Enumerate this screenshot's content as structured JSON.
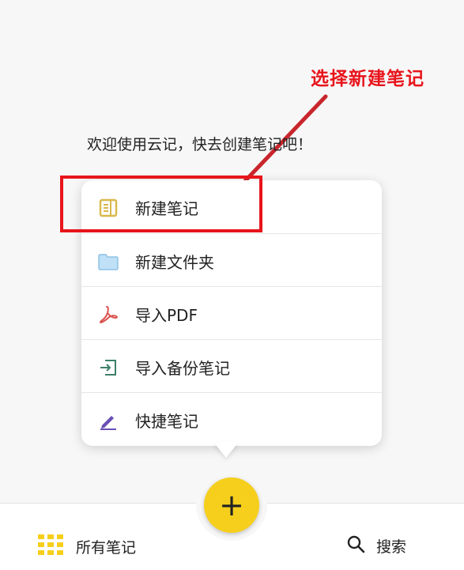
{
  "annotation": {
    "text": "选择新建笔记",
    "color": "#e8141b"
  },
  "welcome": {
    "text": "欢迎使用云记，快去创建笔记吧！"
  },
  "menu": {
    "items": [
      {
        "label": "新建笔记",
        "icon": "note-icon",
        "color": "#d9b84a"
      },
      {
        "label": "新建文件夹",
        "icon": "folder-icon",
        "color": "#9fcbea"
      },
      {
        "label": "导入PDF",
        "icon": "pdf-icon",
        "color": "#d9534f"
      },
      {
        "label": "导入备份笔记",
        "icon": "import-backup-icon",
        "color": "#3f7f6a"
      },
      {
        "label": "快捷笔记",
        "icon": "pencil-icon",
        "color": "#6a4fb5"
      }
    ]
  },
  "fab": {
    "label": "+",
    "color": "#f6cf1d"
  },
  "bottom_nav": {
    "all_notes_label": "所有笔记",
    "search_label": "搜索",
    "accent": "#f6cf1d"
  }
}
